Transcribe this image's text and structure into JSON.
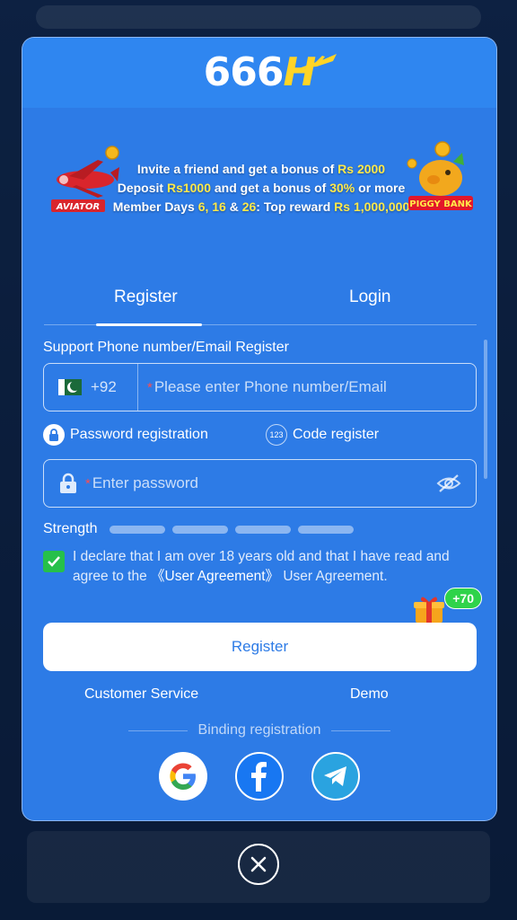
{
  "brand": {
    "logo_text": "666",
    "logo_letter": "H"
  },
  "banner": {
    "line1_prefix": "Invite a friend and get a bonus of ",
    "line1_amount": "Rs 2000",
    "line2_prefix": "Deposit ",
    "line2_amount": "Rs1000",
    "line2_middle": " and get a bonus of ",
    "line2_percent": "30%",
    "line2_suffix": " or more",
    "line3_prefix": "Member Days ",
    "line3_days": "6, 16",
    "line3_and": " & ",
    "line3_day3": "26",
    "line3_middle": ": Top reward ",
    "line3_reward": "Rs 1,000,000",
    "aviator_label": "AVIATOR",
    "piggy_label": "PIGGY BANK"
  },
  "tabs": {
    "register": "Register",
    "login": "Login"
  },
  "form": {
    "section_label": "Support Phone number/Email Register",
    "country_code": "+92",
    "required_mark": "*",
    "phone_placeholder": "Please enter Phone number/Email",
    "password_option": "Password registration",
    "code_option": "Code register",
    "code_option_icon_text": "123",
    "password_placeholder": "Enter password",
    "strength_label": "Strength",
    "agreement_text_1": "I declare that I am over 18 years old and that I have read and agree to the ",
    "agreement_link": "《User Agreement》",
    "agreement_text_2": " User Agreement.",
    "gift_badge": "+70",
    "register_button": "Register"
  },
  "links": {
    "customer_service": "Customer Service",
    "demo": "Demo"
  },
  "binding": {
    "label": "Binding registration"
  },
  "colors": {
    "modal_bg": "#2d7be6",
    "header_bg": "#2f86f0",
    "highlight": "#ffe94a",
    "check_green": "#26c04a",
    "required_red": "#ff4d4f"
  },
  "icons": [
    "plane-icon",
    "aviator-icon",
    "piggy-bank-icon",
    "pakistan-flag-icon",
    "lock-icon",
    "code-123-icon",
    "eye-off-icon",
    "check-icon",
    "gift-icon",
    "google-icon",
    "facebook-icon",
    "telegram-icon",
    "close-icon"
  ]
}
